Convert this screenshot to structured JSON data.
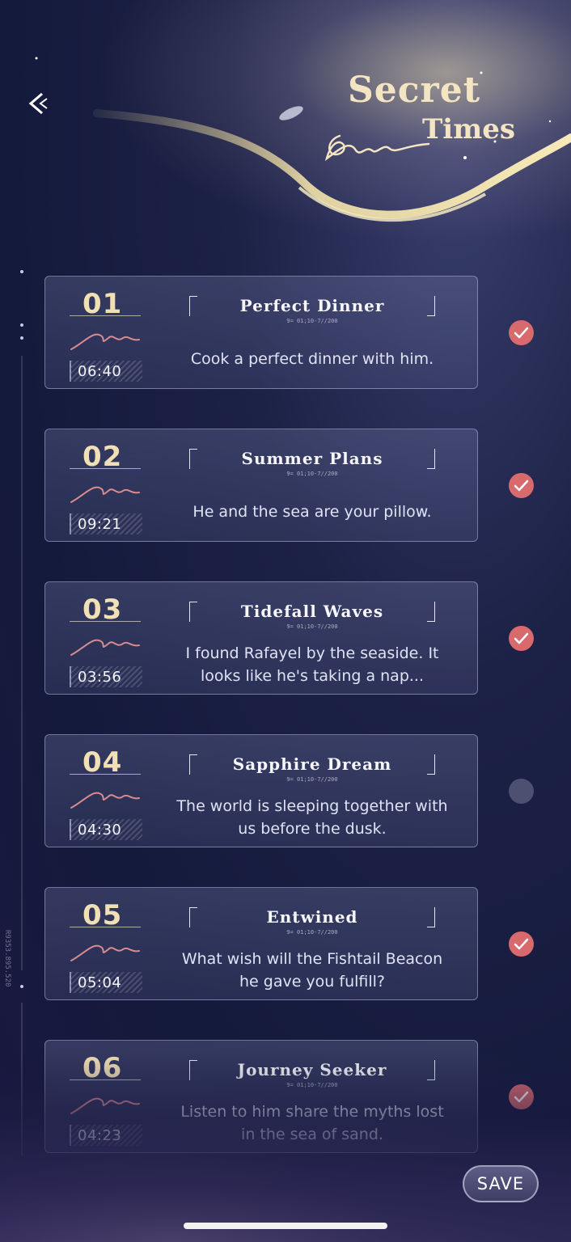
{
  "header": {
    "title_line1": "Secret",
    "title_line2": "Times",
    "back_icon": "chevron-left-icon"
  },
  "side_code": "R9353.895.520",
  "entries": [
    {
      "number": "01",
      "time": "06:40",
      "title": "Perfect Dinner",
      "code": "9= 01;10-7//200",
      "description": "Cook a perfect dinner with him.",
      "completed": true
    },
    {
      "number": "02",
      "time": "09:21",
      "title": "Summer Plans",
      "code": "9= 01;10-7//200",
      "description": "He and the sea are your pillow.",
      "completed": true
    },
    {
      "number": "03",
      "time": "03:56",
      "title": "Tidefall Waves",
      "code": "9= 01;10-7//200",
      "description": "I found Rafayel by the seaside. It looks like he's taking a nap...",
      "completed": true
    },
    {
      "number": "04",
      "time": "04:30",
      "title": "Sapphire Dream",
      "code": "9= 01;10-7//200",
      "description": "The world is sleeping together with us before the dusk.",
      "completed": false
    },
    {
      "number": "05",
      "time": "05:04",
      "title": "Entwined",
      "code": "9= 01;10-7//200",
      "description": "What wish will the Fishtail Beacon he gave you fulfill?",
      "completed": true
    },
    {
      "number": "06",
      "time": "04:23",
      "title": "Journey Seeker",
      "code": "9= 01;10-7//200",
      "description": "Listen to him share the myths lost in the sea of sand.",
      "completed": true
    }
  ],
  "save_button": {
    "label": "SAVE"
  },
  "colors": {
    "accent_gold": "#f1dfb5",
    "check_done": "#d86a6e",
    "background": "#1c2146"
  }
}
